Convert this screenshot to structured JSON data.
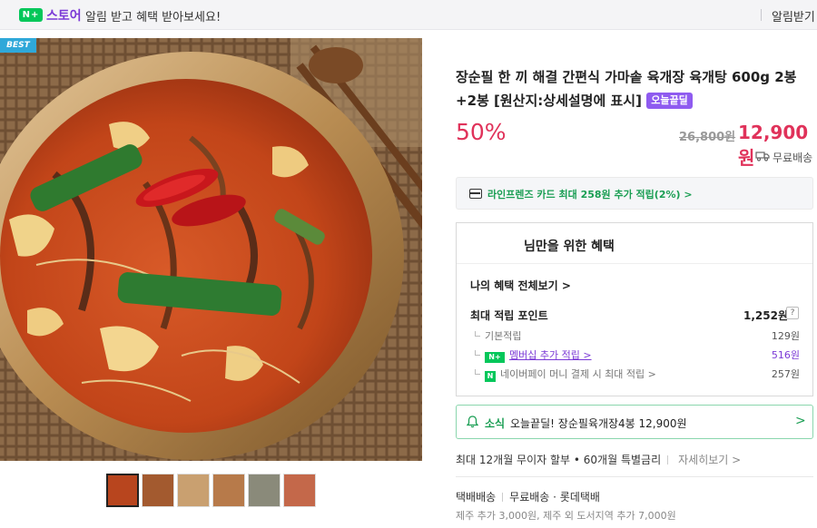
{
  "topbar": {
    "logo_badge": "N+",
    "logo_text": "스토어",
    "alert_text": "알림 받고 혜택 받아보세요!",
    "right_text": "알림받기"
  },
  "image": {
    "best_badge": "BEST",
    "thumbnail_count": 6
  },
  "product": {
    "title": "장순필 한 끼 해결 간편식 가마솥 육개장 육개탕 600g 2봉+2봉 [원산지:상세설명에 표시]",
    "today_badge": "오늘끝딜",
    "discount": "50%",
    "original_price": "26,800원",
    "sale_price": "12,900원",
    "shipping": "무료배송"
  },
  "card_benefit": {
    "text": "라인프렌즈 카드 최대 258원 추가 적립(2%) >"
  },
  "benefits": {
    "heading": "님만을 위한 혜택",
    "view_all": "나의 혜택 전체보기 >",
    "max_point_label": "최대 적립 포인트",
    "max_point_value": "1,252원",
    "help_label": "?",
    "rows": [
      {
        "label": "기본적립",
        "value": "129원"
      },
      {
        "label": "멤버십 추가 적립 >",
        "value": "516원"
      },
      {
        "label": "네이버페이 머니 결제 시 최대 적립 >",
        "value": "257원"
      }
    ],
    "membership_badge": "N+",
    "npay_badge": "N"
  },
  "news": {
    "label": "소식",
    "text": "오늘끝딜! 장순필육개장4봉 12,900원",
    "arrow": ">"
  },
  "installment": {
    "text": "최대 12개월 무이자 할부 • 60개월 특별금리",
    "more": "자세히보기 >"
  },
  "delivery": {
    "method": "택배배송",
    "fee": "무료배송",
    "carrier": "롯데택배",
    "extra": "제주 추가 3,000원, 제주 외 도서지역 추가 7,000원"
  },
  "colors": {
    "accent_red": "#e0325a",
    "naver_green": "#03c75a",
    "purple": "#7b39d6"
  }
}
